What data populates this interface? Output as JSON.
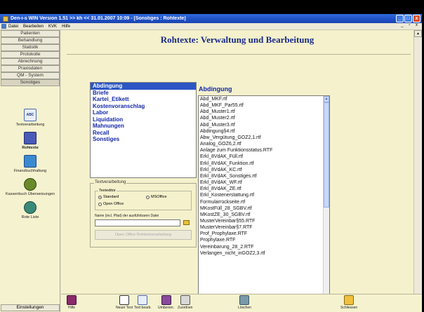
{
  "window": {
    "title": "Den-i-s WIN Version 1.51 >> kh << 31.01.2007  10:09 - [Sonstiges : Rohtexte]",
    "controls": [
      "_",
      "□",
      "x"
    ]
  },
  "menubar": {
    "items": [
      "Datei",
      "Bearbeiten",
      "KVK",
      "Hilfe"
    ],
    "mdi_controls": "_ ▫ x"
  },
  "sidebar": {
    "nav": [
      "Patienten",
      "Behandlung",
      "Statistik",
      "Protokolle",
      "Abrechnung",
      "Praxisdaten",
      "QM - System",
      "Sonstiges"
    ],
    "tools": [
      {
        "label": "Textverarbeitung",
        "icon": "abc-document-icon"
      },
      {
        "label": "Rohtexte",
        "icon": "rohtexte-book-icon"
      },
      {
        "label": "Finanzbuchhaltung",
        "icon": "finance-book-icon"
      },
      {
        "label": "Kassenbuch Überweisungen",
        "icon": "money-bag-icon"
      },
      {
        "label": "Rote Liste",
        "icon": "caduceus-icon"
      }
    ],
    "settings": "Einstellungen"
  },
  "main": {
    "title": "Rohtexte: Verwaltung und Bearbeitung",
    "categories": [
      "Abdingung",
      "Briefe",
      "Kartei_Etikett",
      "Kostenvoranschlag",
      "Labor",
      "Liquidation",
      "Mahnungen",
      "Recall",
      "Sonstiges"
    ],
    "selected_category": "Abdingung",
    "text_processing": {
      "frame_title": "Textverarbeitung",
      "editor_group_title": "Texteditor",
      "option_standard": "Standard",
      "option_msoffice": "MSOffice",
      "option_openoffice": "Open Office",
      "selected_option": "Standard",
      "path_label": "Name (incl. Pfad) der ausführbaren Datei",
      "path_value": "",
      "oo_button": "Open Office Rohtextverarbeitung"
    },
    "files_heading": "Abdingung",
    "files": [
      "Abd_MKF.rtf",
      "Abd_MKF_Par55.rtf",
      "Abd_Muster1.rtf",
      "Abd_Muster2.rtf",
      "Abd_Muster3.rtf",
      "Abdingung§4.rtf",
      "Abw_Vergütung_GOZ2,1.rtf",
      "Analog_GOZ6,2.rtf",
      "Anlage zum Funktionsstatus.RTF",
      "Erkl_8VdAK_Füll.rtf",
      "Erkl_8VdAK_Funktion.rtf",
      "Erkl_8VdAK_KC.rtf",
      "Erkl_8VdAK_Sonstiges.rtf",
      "Erkl_8VdAK_WF.rtf",
      "Erkl_8VdAK_ZE.rtf",
      "Erkl_Kostenerstattung.rtf",
      "Formularrückseite.rtf",
      "MKostFüll_28_SGBV.rtf",
      "MKostZE_30_SGBV.rtf",
      "MusterVereinbar§55.RTF",
      "MusterVereinbar§7.RTF",
      "Prof_Prophylaxe.RTF",
      "Prophylaxe.RTF",
      "Vereinbarung_28_2.RTF",
      "Verlangen_nicht_inGOZ2,3.rtf"
    ]
  },
  "toolbar": {
    "buttons": [
      {
        "label": "Hilfe",
        "icon": "help-book-icon"
      },
      {
        "label": "Neuer Text",
        "icon": "new-document-icon"
      },
      {
        "label": "Text bearb.",
        "icon": "edit-text-icon"
      },
      {
        "label": "Umbenen.",
        "icon": "rename-icon"
      },
      {
        "label": "Zuordnen",
        "icon": "assign-icon"
      },
      {
        "label": "Löschen",
        "icon": "trash-icon"
      },
      {
        "label": "Schliessen",
        "icon": "exit-door-icon"
      }
    ]
  },
  "colors": {
    "title_blue": "#1a2a8a",
    "link_blue": "#1428a8",
    "selection": "#2c56c4",
    "panel_bg": "#f4f1cc"
  }
}
